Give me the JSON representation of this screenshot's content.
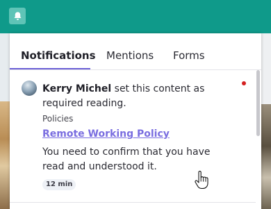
{
  "topbar": {
    "notifications_icon": "bell-icon"
  },
  "tabs": [
    {
      "label": "Notifications",
      "active": true
    },
    {
      "label": "Mentions",
      "active": false
    },
    {
      "label": "Forms",
      "active": false
    }
  ],
  "notification": {
    "author": "Kerry Michel",
    "action": " set this content as required reading.",
    "category": "Policies",
    "title": "Remote Working Policy",
    "message": "You need to confirm that you have read and understood it.",
    "time": "12 min",
    "unread": true
  },
  "colors": {
    "header": "#0f9a8a",
    "accent": "#6a5fd6",
    "link": "#7a6ee0",
    "unread_dot": "#d42020"
  }
}
